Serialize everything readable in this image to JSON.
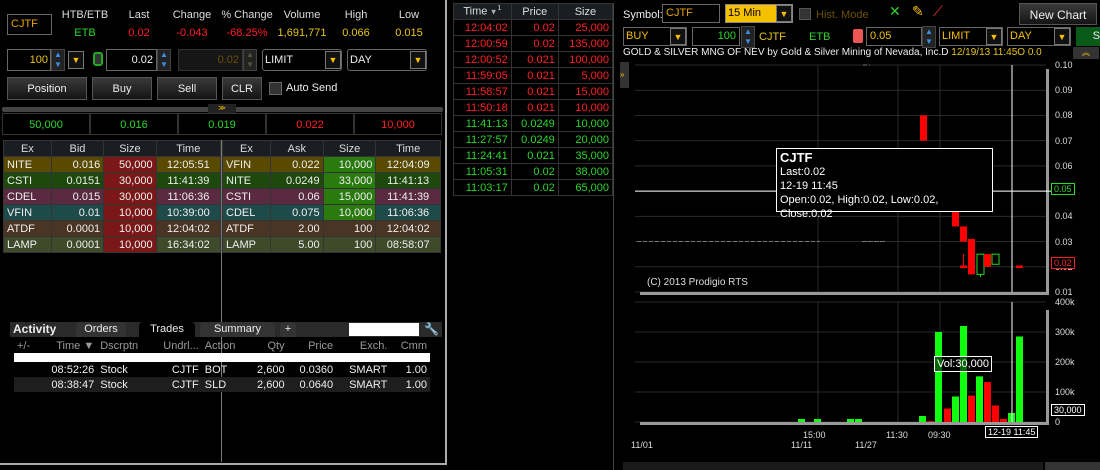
{
  "quote": {
    "symbol": "CJTF",
    "headers": [
      "HTB/ETB",
      "Last",
      "Change",
      "% Change",
      "Volume",
      "High",
      "Low"
    ],
    "values": [
      "ETB",
      "0.02",
      "-0.043",
      "-68.25%",
      "1,691,771",
      "0.066",
      "0.015"
    ]
  },
  "order": {
    "quantity": "100",
    "limit_price": "0.02",
    "aux_price": "0.02",
    "order_type": "LIMIT",
    "tif": "DAY"
  },
  "buttons": {
    "position": "Position",
    "buy": "Buy",
    "sell": "Sell",
    "clr": "CLR",
    "auto_send": "Auto Send"
  },
  "best": {
    "bid_size": "50,000",
    "bid": "0.016",
    "last": "0.019",
    "ask": "0.022",
    "ask_size": "10,000"
  },
  "book": {
    "bid_headers": [
      "Ex",
      "Bid",
      "Size",
      "Time"
    ],
    "ask_headers": [
      "Ex",
      "Ask",
      "Size",
      "Time"
    ],
    "bids": [
      [
        "NITE",
        "0.016",
        "50,000",
        "12:05:51"
      ],
      [
        "CSTI",
        "0.0151",
        "30,000",
        "11:41:39"
      ],
      [
        "CDEL",
        "0.015",
        "30,000",
        "11:06:36"
      ],
      [
        "VFIN",
        "0.01",
        "10,000",
        "10:39:00"
      ],
      [
        "ATDF",
        "0.0001",
        "10,000",
        "12:04:02"
      ],
      [
        "LAMP",
        "0.0001",
        "10,000",
        "16:34:02"
      ]
    ],
    "asks": [
      [
        "VFIN",
        "0.022",
        "10,000",
        "12:04:09"
      ],
      [
        "NITE",
        "0.0249",
        "33,000",
        "11:41:13"
      ],
      [
        "CSTI",
        "0.06",
        "15,000",
        "11:41:39"
      ],
      [
        "CDEL",
        "0.075",
        "10,000",
        "11:06:36"
      ],
      [
        "ATDF",
        "2.00",
        "100",
        "12:04:02"
      ],
      [
        "LAMP",
        "5.00",
        "100",
        "08:58:07"
      ]
    ],
    "row_colors": [
      "#5a4a00",
      "#1d4a0c",
      "#5a2a40",
      "#1f4a4a",
      "#4a3424",
      "#3f4a2a"
    ]
  },
  "activity": {
    "title": "Activity",
    "tabs": [
      "Orders",
      "Trades",
      "Summary",
      "+"
    ],
    "active_tab": "Trades",
    "columns": [
      "+/-",
      "Time ▼",
      "Dscrptn",
      "Undrl...",
      "Action",
      "Qty",
      "Price",
      "Exch.",
      "Cmm"
    ],
    "rows": [
      [
        "",
        "08:52:26",
        "Stock",
        "CJTF",
        "BOT",
        "2,600",
        "0.0360",
        "SMART",
        "1.00"
      ],
      [
        "",
        "08:38:47",
        "Stock",
        "CJTF",
        "SLD",
        "2,600",
        "0.0640",
        "SMART",
        "1.00"
      ]
    ]
  },
  "time_sales": {
    "headers": [
      "Time",
      "Price",
      "Size"
    ],
    "sort_marker": "1",
    "rows": [
      [
        "12:04:02",
        "0.02",
        "25,000",
        "r"
      ],
      [
        "12:00:59",
        "0.02",
        "135,000",
        "r"
      ],
      [
        "12:00:52",
        "0.021",
        "100,000",
        "r"
      ],
      [
        "11:59:05",
        "0.021",
        "5,000",
        "r"
      ],
      [
        "11:58:57",
        "0.021",
        "15,000",
        "r"
      ],
      [
        "11:50:18",
        "0.021",
        "10,000",
        "r"
      ],
      [
        "11:41:13",
        "0.0249",
        "10,000",
        "g"
      ],
      [
        "11:27:57",
        "0.0249",
        "20,000",
        "g"
      ],
      [
        "11:24:41",
        "0.021",
        "35,000",
        "g"
      ],
      [
        "11:05:31",
        "0.02",
        "38,000",
        "g"
      ],
      [
        "11:03:17",
        "0.02",
        "65,000",
        "g"
      ]
    ]
  },
  "chart": {
    "symbol_label": "Symbol:",
    "symbol": "CJTF",
    "interval": "15 Min",
    "hist_mode": "Hist. Mode",
    "new_chart": "New Chart",
    "side": "BUY",
    "qty": "100",
    "sym": "CJTF",
    "etb": "ETB",
    "price": "0.05",
    "type": "LIMIT",
    "tif": "DAY",
    "submit": "S",
    "title": "GOLD & SILVER MNG OF NEV by Gold & Silver Mining of Nevada, Inc.D",
    "title_time": "12/19/13 11:45",
    "title_tail": "O 0.0",
    "copyright": "(C) 2013 Prodigio RTS",
    "tooltip": {
      "symbol": "CJTF",
      "last": "Last:0.02",
      "time": "12-19 11:45",
      "ohlc": "Open:0.02, High:0.02, Low:0.02, Close:0.02"
    },
    "crosshair_price": "0.05",
    "last_price_tag": "0.02",
    "vol_tooltip": "Vol:30,000",
    "vol_tag": "30,000",
    "time_tag": "12-19 11:45"
  },
  "chart_data": {
    "type": "candlestick+bar",
    "price_axis": {
      "ticks": [
        "0.10",
        "0.09",
        "0.08",
        "0.07",
        "0.06",
        "0.05",
        "0.04",
        "0.03",
        "0.02",
        "0.01"
      ],
      "range": [
        0.01,
        0.1
      ]
    },
    "volume_axis": {
      "ticks": [
        "400k",
        "300k",
        "200k",
        "100k",
        "0"
      ],
      "range": [
        0,
        400000
      ]
    },
    "x_ticks_top": [
      "15:00",
      "11:30",
      "09:30"
    ],
    "x_ticks_bottom": [
      "11/01",
      "11/11",
      "11/27"
    ],
    "candles": [
      {
        "o": 0.08,
        "h": 0.08,
        "l": 0.07,
        "c": 0.07
      },
      {
        "o": 0.066,
        "h": 0.066,
        "l": 0.061,
        "c": 0.061,
        "dim": true
      },
      {
        "o": 0.06,
        "h": 0.06,
        "l": 0.045,
        "c": 0.045,
        "dim": true
      },
      {
        "o": 0.045,
        "h": 0.045,
        "l": 0.036,
        "c": 0.036
      },
      {
        "o": 0.036,
        "h": 0.036,
        "l": 0.03,
        "c": 0.03
      },
      {
        "o": 0.0205,
        "h": 0.025,
        "l": 0.0195,
        "c": 0.0195
      },
      {
        "o": 0.031,
        "h": 0.031,
        "l": 0.017,
        "c": 0.017
      },
      {
        "o": 0.017,
        "h": 0.025,
        "l": 0.016,
        "c": 0.025
      },
      {
        "o": 0.025,
        "h": 0.025,
        "l": 0.02,
        "c": 0.02
      },
      {
        "o": 0.021,
        "h": 0.025,
        "l": 0.021,
        "c": 0.025
      },
      {
        "o": 0.0205,
        "h": 0.0205,
        "l": 0.0195,
        "c": 0.0195
      }
    ],
    "volumes": [
      {
        "v": 10000,
        "up": true
      },
      {
        "v": 10000,
        "up": true
      },
      {
        "v": 10000,
        "up": true
      },
      {
        "v": 10000,
        "up": true
      },
      {
        "v": 20000,
        "up": true
      },
      {
        "v": 3000,
        "up": false
      },
      {
        "v": 300000,
        "up": true
      },
      {
        "v": 45000,
        "up": false
      },
      {
        "v": 85000,
        "up": true
      },
      {
        "v": 320000,
        "up": true
      },
      {
        "v": 88000,
        "up": false
      },
      {
        "v": 152000,
        "up": true
      },
      {
        "v": 133000,
        "up": false
      },
      {
        "v": 55000,
        "up": false
      },
      {
        "v": 10000,
        "up": false
      },
      {
        "v": 30000,
        "up": true
      },
      {
        "v": 285000,
        "up": true
      }
    ]
  }
}
